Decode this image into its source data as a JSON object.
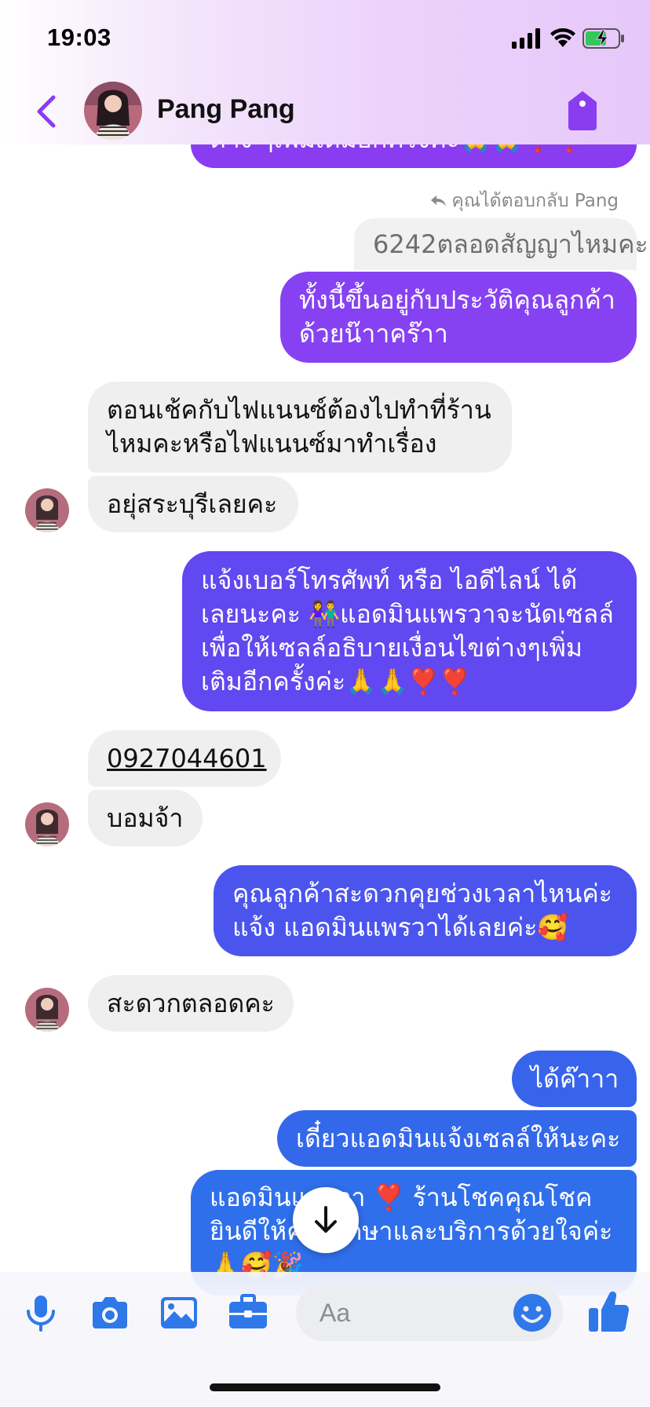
{
  "status_bar": {
    "time": "19:03"
  },
  "header": {
    "contact_name": "Pang Pang"
  },
  "colors": {
    "accent": "#8a3cf0",
    "messenger_blue": "#2f78ea",
    "incoming_bubble": "#efefef"
  },
  "messages": {
    "top_partial": "ต่าง ๆเพิ่มเติมอีกครั้งค่ะ🙏🙏❣️❣️",
    "reply_note": "คุณได้ตอบกลับ Pang",
    "quoted": "6242ตลอดสัญญาไหมคะ",
    "out_1_l1": "ทั้งนี้ขึ้นอยู่กับประวัติคุณลูกค้า",
    "out_1_l2": "ด้วยน๊าาคร๊าา",
    "in_1_l1": "ตอนเช้คกับไฟแนนซ์ต้องไปทำที่ร้าน",
    "in_1_l2": "ไหมคะหรือไฟแนนซ์มาทำเรื่อง",
    "in_2": "อยุ่สระบุรีเลยคะ",
    "out_2_l1": "แจ้งเบอร์โทรศัพท์ หรือ ไอดีไลน์  ได้",
    "out_2_l2": "เลยนะคะ 👫แอดมินแพรวาจะนัดเซลล์",
    "out_2_l3": "เพื่อให้เซลล์อธิบายเงื่อนไขต่างๆเพิ่ม",
    "out_2_l4": "เติมอีกครั้งค่ะ🙏🙏❣️❣️",
    "in_3": "0927044601",
    "in_4": "บอมจ้า",
    "out_3_l1": "คุณลูกค้าสะดวกคุยช่วงเวลาไหนค่ะ",
    "out_3_l2": "แจ้ง แอดมินแพรวาได้เลยค่ะ🥰",
    "in_5": "สะดวกตลอดคะ",
    "out_4": "ได้ค๊าาา",
    "out_5": "เดี๋ยวแอดมินแจ้งเซลล์ให้นะคะ",
    "out_6_l1": "แอดมินแพรวา ❣️ ร้านโชคคุณโชค",
    "out_6_l2": "ยินดีให้คำปรึกษาและบริการด้วยใจค่ะ",
    "out_6_l3": "🙏🥰🎉"
  },
  "composer": {
    "placeholder": "Aa"
  },
  "icons": [
    "back-icon",
    "tag-icon",
    "reply-icon",
    "scroll-down-icon",
    "microphone-icon",
    "camera-icon",
    "image-icon",
    "toolbox-icon",
    "emoji-icon",
    "like-icon"
  ]
}
